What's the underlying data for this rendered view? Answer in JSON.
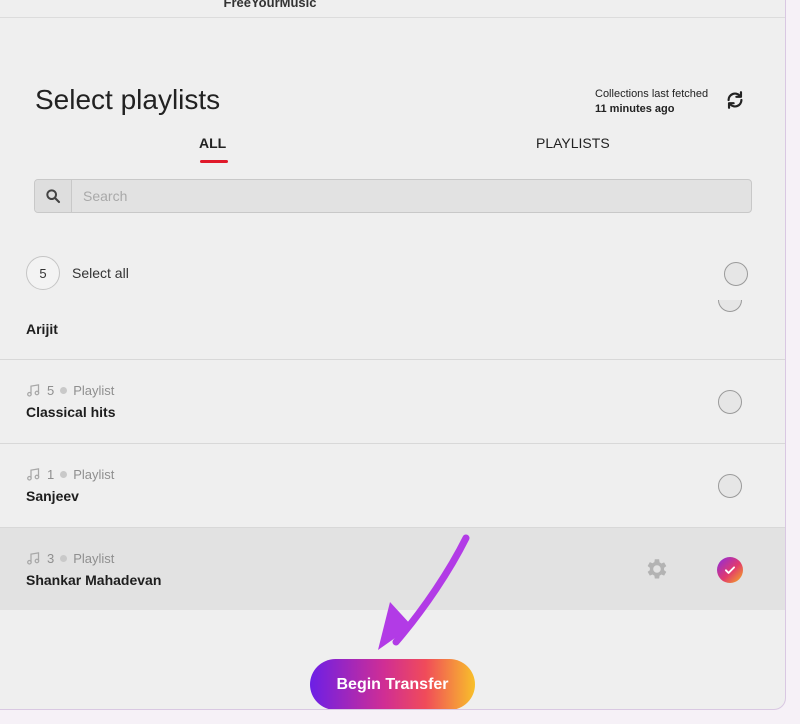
{
  "app": {
    "title": "FreeYourMusic"
  },
  "header": {
    "title": "Select playlists",
    "fetched_label": "Collections last fetched",
    "fetched_when": "11 minutes ago",
    "refresh_icon": "refresh-icon"
  },
  "tabs": [
    {
      "label": "ALL",
      "active": true
    },
    {
      "label": "PLAYLISTS",
      "active": false
    }
  ],
  "search": {
    "placeholder": "Search",
    "value": ""
  },
  "select_all": {
    "count": "5",
    "label": "Select all",
    "checked": false
  },
  "items": [
    {
      "name": "Arijit",
      "type": "",
      "count": "",
      "selected": false
    },
    {
      "name": "Classical hits",
      "type": "Playlist",
      "count": "5",
      "selected": false
    },
    {
      "name": "Sanjeev",
      "type": "Playlist",
      "count": "1",
      "selected": false
    },
    {
      "name": "Shankar Mahadevan",
      "type": "Playlist",
      "count": "3",
      "selected": true
    }
  ],
  "footer": {
    "begin_label": "Begin Transfer"
  },
  "colors": {
    "accent_red": "#e0192a",
    "gradient_start": "#6c1fe6",
    "gradient_mid": "#f04b5a",
    "gradient_end": "#f8c02a",
    "annotation_arrow": "#b23be6"
  }
}
